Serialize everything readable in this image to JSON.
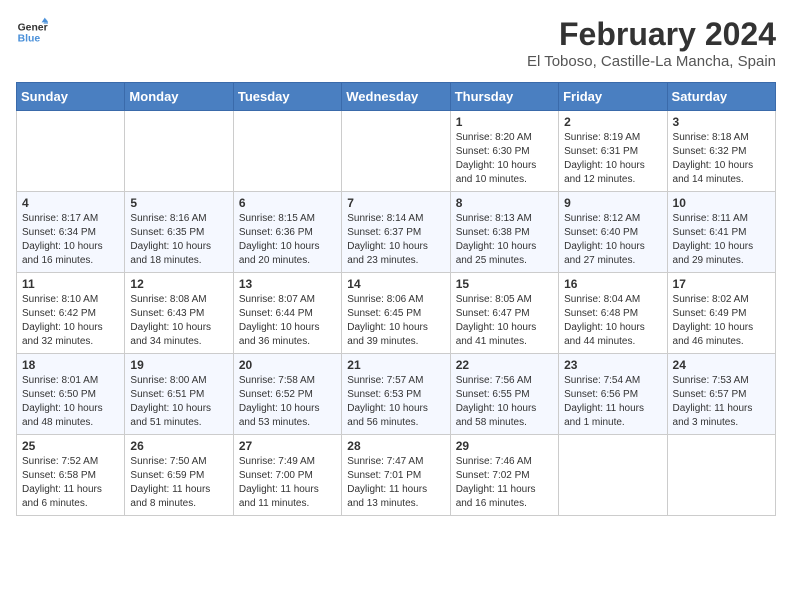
{
  "header": {
    "logo_general": "General",
    "logo_blue": "Blue",
    "main_title": "February 2024",
    "subtitle": "El Toboso, Castille-La Mancha, Spain"
  },
  "calendar": {
    "days_of_week": [
      "Sunday",
      "Monday",
      "Tuesday",
      "Wednesday",
      "Thursday",
      "Friday",
      "Saturday"
    ],
    "weeks": [
      [
        {
          "day": "",
          "info": ""
        },
        {
          "day": "",
          "info": ""
        },
        {
          "day": "",
          "info": ""
        },
        {
          "day": "",
          "info": ""
        },
        {
          "day": "1",
          "info": "Sunrise: 8:20 AM\nSunset: 6:30 PM\nDaylight: 10 hours\nand 10 minutes."
        },
        {
          "day": "2",
          "info": "Sunrise: 8:19 AM\nSunset: 6:31 PM\nDaylight: 10 hours\nand 12 minutes."
        },
        {
          "day": "3",
          "info": "Sunrise: 8:18 AM\nSunset: 6:32 PM\nDaylight: 10 hours\nand 14 minutes."
        }
      ],
      [
        {
          "day": "4",
          "info": "Sunrise: 8:17 AM\nSunset: 6:34 PM\nDaylight: 10 hours\nand 16 minutes."
        },
        {
          "day": "5",
          "info": "Sunrise: 8:16 AM\nSunset: 6:35 PM\nDaylight: 10 hours\nand 18 minutes."
        },
        {
          "day": "6",
          "info": "Sunrise: 8:15 AM\nSunset: 6:36 PM\nDaylight: 10 hours\nand 20 minutes."
        },
        {
          "day": "7",
          "info": "Sunrise: 8:14 AM\nSunset: 6:37 PM\nDaylight: 10 hours\nand 23 minutes."
        },
        {
          "day": "8",
          "info": "Sunrise: 8:13 AM\nSunset: 6:38 PM\nDaylight: 10 hours\nand 25 minutes."
        },
        {
          "day": "9",
          "info": "Sunrise: 8:12 AM\nSunset: 6:40 PM\nDaylight: 10 hours\nand 27 minutes."
        },
        {
          "day": "10",
          "info": "Sunrise: 8:11 AM\nSunset: 6:41 PM\nDaylight: 10 hours\nand 29 minutes."
        }
      ],
      [
        {
          "day": "11",
          "info": "Sunrise: 8:10 AM\nSunset: 6:42 PM\nDaylight: 10 hours\nand 32 minutes."
        },
        {
          "day": "12",
          "info": "Sunrise: 8:08 AM\nSunset: 6:43 PM\nDaylight: 10 hours\nand 34 minutes."
        },
        {
          "day": "13",
          "info": "Sunrise: 8:07 AM\nSunset: 6:44 PM\nDaylight: 10 hours\nand 36 minutes."
        },
        {
          "day": "14",
          "info": "Sunrise: 8:06 AM\nSunset: 6:45 PM\nDaylight: 10 hours\nand 39 minutes."
        },
        {
          "day": "15",
          "info": "Sunrise: 8:05 AM\nSunset: 6:47 PM\nDaylight: 10 hours\nand 41 minutes."
        },
        {
          "day": "16",
          "info": "Sunrise: 8:04 AM\nSunset: 6:48 PM\nDaylight: 10 hours\nand 44 minutes."
        },
        {
          "day": "17",
          "info": "Sunrise: 8:02 AM\nSunset: 6:49 PM\nDaylight: 10 hours\nand 46 minutes."
        }
      ],
      [
        {
          "day": "18",
          "info": "Sunrise: 8:01 AM\nSunset: 6:50 PM\nDaylight: 10 hours\nand 48 minutes."
        },
        {
          "day": "19",
          "info": "Sunrise: 8:00 AM\nSunset: 6:51 PM\nDaylight: 10 hours\nand 51 minutes."
        },
        {
          "day": "20",
          "info": "Sunrise: 7:58 AM\nSunset: 6:52 PM\nDaylight: 10 hours\nand 53 minutes."
        },
        {
          "day": "21",
          "info": "Sunrise: 7:57 AM\nSunset: 6:53 PM\nDaylight: 10 hours\nand 56 minutes."
        },
        {
          "day": "22",
          "info": "Sunrise: 7:56 AM\nSunset: 6:55 PM\nDaylight: 10 hours\nand 58 minutes."
        },
        {
          "day": "23",
          "info": "Sunrise: 7:54 AM\nSunset: 6:56 PM\nDaylight: 11 hours\nand 1 minute."
        },
        {
          "day": "24",
          "info": "Sunrise: 7:53 AM\nSunset: 6:57 PM\nDaylight: 11 hours\nand 3 minutes."
        }
      ],
      [
        {
          "day": "25",
          "info": "Sunrise: 7:52 AM\nSunset: 6:58 PM\nDaylight: 11 hours\nand 6 minutes."
        },
        {
          "day": "26",
          "info": "Sunrise: 7:50 AM\nSunset: 6:59 PM\nDaylight: 11 hours\nand 8 minutes."
        },
        {
          "day": "27",
          "info": "Sunrise: 7:49 AM\nSunset: 7:00 PM\nDaylight: 11 hours\nand 11 minutes."
        },
        {
          "day": "28",
          "info": "Sunrise: 7:47 AM\nSunset: 7:01 PM\nDaylight: 11 hours\nand 13 minutes."
        },
        {
          "day": "29",
          "info": "Sunrise: 7:46 AM\nSunset: 7:02 PM\nDaylight: 11 hours\nand 16 minutes."
        },
        {
          "day": "",
          "info": ""
        },
        {
          "day": "",
          "info": ""
        }
      ]
    ]
  }
}
